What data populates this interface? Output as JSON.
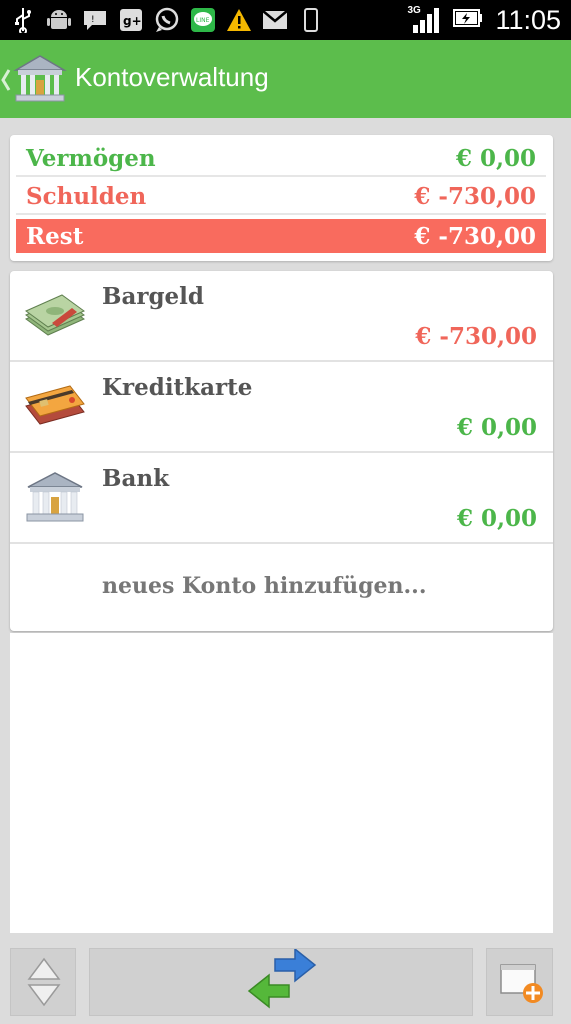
{
  "status_bar": {
    "time": "11:05",
    "network": "3G",
    "icons_left": [
      "usb-icon",
      "android-icon",
      "chat-icon",
      "google-plus-icon",
      "whatsapp-icon",
      "line-icon",
      "warning-icon",
      "gmail-icon",
      "phone-icon"
    ],
    "icons_right": [
      "signal-icon",
      "battery-icon"
    ]
  },
  "action_bar": {
    "title": "Kontoverwaltung",
    "color": "#5cbd4c"
  },
  "summary": {
    "assets_label": "Vermögen",
    "assets_value": "€ 0,00",
    "debts_label": "Schulden",
    "debts_value": "€ -730,00",
    "rest_label": "Rest",
    "rest_value": "€ -730,00",
    "positive_color": "#4cb64a",
    "negative_color": "#f0665a"
  },
  "accounts": [
    {
      "name": "Bargeld",
      "balance": "€ -730,00",
      "icon": "cash-icon",
      "negative": true
    },
    {
      "name": "Kreditkarte",
      "balance": "€ 0,00",
      "icon": "credit-card-icon",
      "negative": false
    },
    {
      "name": "Bank",
      "balance": "€ 0,00",
      "icon": "bank-icon",
      "negative": false
    }
  ],
  "add_account_label": "neues Konto hinzufügen...",
  "toolbar": {
    "sort_icon": "sort-icon",
    "transfer_icon": "transfer-icon",
    "add_icon": "add-account-icon"
  }
}
